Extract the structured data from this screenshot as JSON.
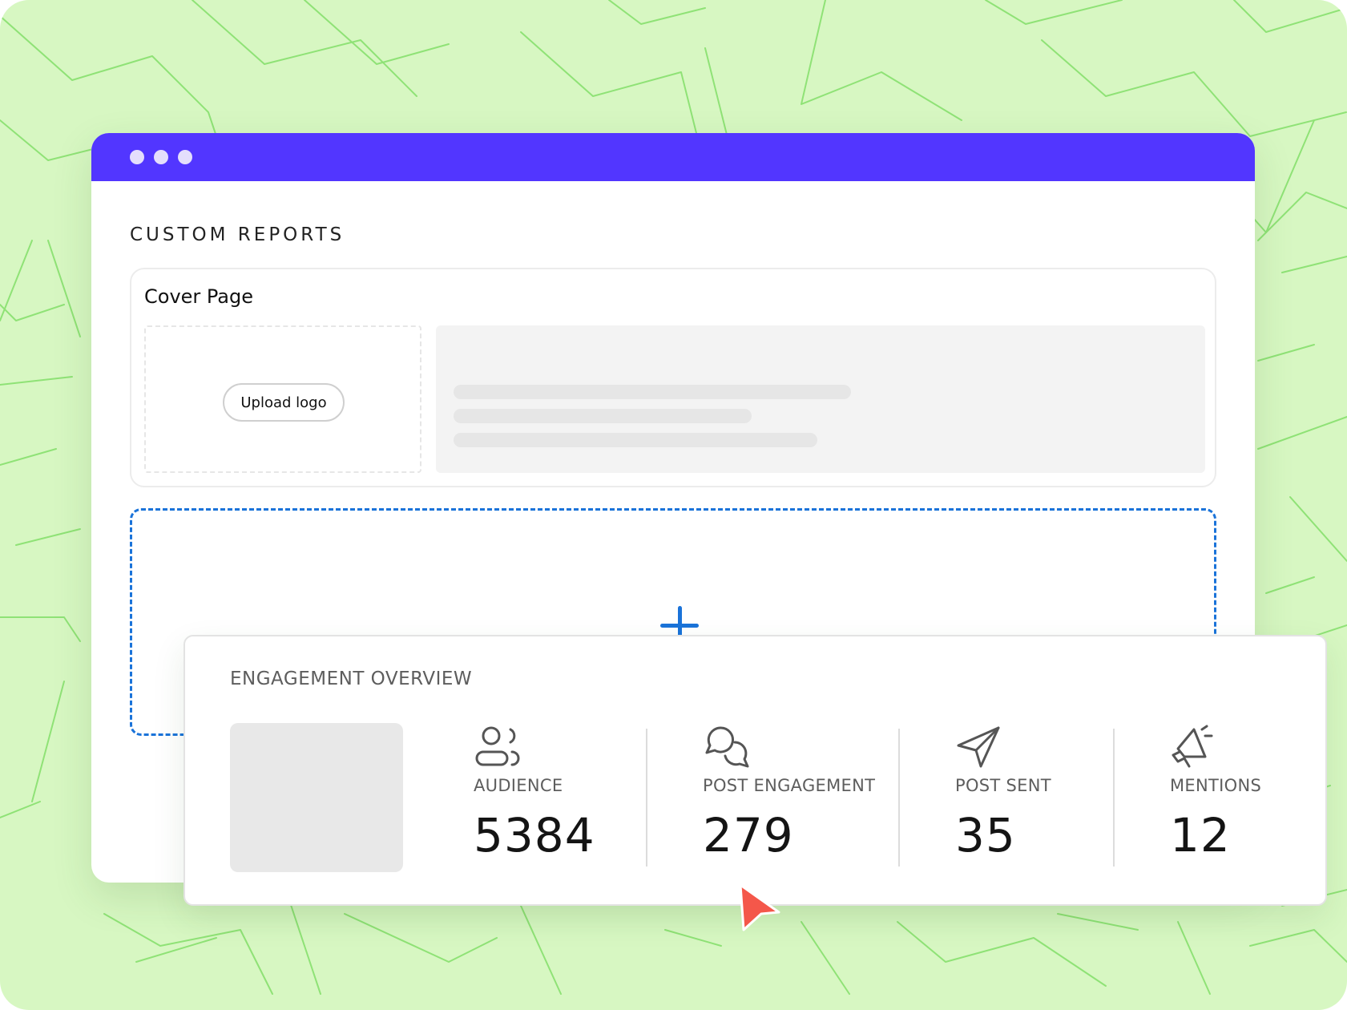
{
  "report": {
    "title": "CUSTOM REPORTS",
    "cover": {
      "title": "Cover Page",
      "upload_label": "Upload logo"
    },
    "add_section_icon": "plus-icon"
  },
  "overview": {
    "title": "ENGAGEMENT OVERVIEW",
    "stats": [
      {
        "icon": "audience-icon",
        "label": "AUDIENCE",
        "value": "5384"
      },
      {
        "icon": "post-engagement-icon",
        "label": "POST ENGAGEMENT",
        "value": "279"
      },
      {
        "icon": "paper-plane-icon",
        "label": "POST SENT",
        "value": "35"
      },
      {
        "icon": "megaphone-icon",
        "label": "MENTIONS",
        "value": "12"
      }
    ]
  },
  "colors": {
    "background": "#d7f7c2",
    "background_lines": "#8fe276",
    "titlebar": "#5236ff",
    "accent_blue": "#1a73d9",
    "cursor": "#f4574a"
  }
}
